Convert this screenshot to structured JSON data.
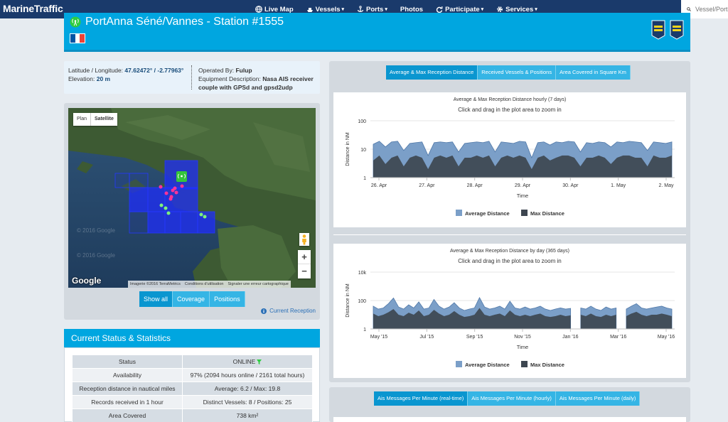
{
  "nav": {
    "logo": "MarineTraffic",
    "items": [
      {
        "label": "Live Map",
        "icon": "globe-icon",
        "caret": false
      },
      {
        "label": "Vessels",
        "icon": "ship-icon",
        "caret": true
      },
      {
        "label": "Ports",
        "icon": "anchor-icon",
        "caret": true
      },
      {
        "label": "Photos",
        "icon": "",
        "caret": false
      },
      {
        "label": "Participate",
        "icon": "refresh-icon",
        "caret": true
      },
      {
        "label": "Services",
        "icon": "gear-icon",
        "caret": true
      }
    ],
    "search_placeholder": "Vessel/Port"
  },
  "station": {
    "title": "PortAnna Séné/Vannes - Station #1555",
    "flag_colors": [
      "#0055a4",
      "#ffffff",
      "#ef4135"
    ],
    "accent": "#00a6e0"
  },
  "info": {
    "latlon_label": "Latitude / Longitude:",
    "latlon_value": "47.62472° / -2.77963°",
    "elevation_label": "Elevation:",
    "elevation_value": "20 m",
    "operated_label": "Operated By:",
    "operated_value": "Fulup",
    "equipment_label": "Equipment Description:",
    "equipment_value": "Nasa AIS receiver couple with GPSd and gpsd2udp"
  },
  "map": {
    "type_buttons": [
      "Plan",
      "Satellite"
    ],
    "watermark": "© 2016 Google",
    "google": "Google",
    "attribution": [
      "Imagerie ©2016 TerraMetrics",
      "Conditions d'utilisation",
      "Signaler une erreur cartographique"
    ],
    "view_buttons": [
      "Show all",
      "Coverage",
      "Positions"
    ],
    "current_reception": "Current Reception"
  },
  "status": {
    "heading": "Current Status & Statistics",
    "rows": [
      [
        "Status",
        "ONLINE"
      ],
      [
        "Availability",
        "97% (2094 hours online / 2161 total hours)"
      ],
      [
        "Reception distance in nautical miles",
        "Average: 6.2 / Max: 19.8"
      ],
      [
        "Records received in 1 hour",
        "Distinct Vessels: 8 / Positions: 25"
      ],
      [
        "Area Covered",
        "738 km²"
      ]
    ]
  },
  "charts": {
    "tabs_top": [
      "Average & Max Reception Distance",
      "Received Vessels & Positions",
      "Area Covered in Square Km"
    ],
    "tabs_bottom": [
      "Ais Messages Per Minute (real-time)",
      "Ais Messages Per Minute (hourly)",
      "Ais Messages Per Minute (daily)"
    ],
    "zoom_hint": "Click and drag in the plot area to zoom in"
  },
  "chart_data": [
    {
      "type": "area",
      "title": "Average & Max Reception Distance hourly (7 days)",
      "xlabel": "Time",
      "ylabel": "Distance in NM",
      "yscale": "log",
      "ylim": [
        1,
        100
      ],
      "y_ticks": [
        "1",
        "10",
        "100"
      ],
      "x_ticks": [
        "26. Apr",
        "27. Apr",
        "28. Apr",
        "29. Apr",
        "30. Apr",
        "1. May",
        "2. May"
      ],
      "legend": "bottom-center",
      "series": [
        {
          "name": "Average Distance",
          "color": "#7b9fc8"
        },
        {
          "name": "Max Distance",
          "color": "#3d4650"
        }
      ],
      "max_values": [
        15,
        19,
        12,
        18,
        19,
        9,
        16,
        17,
        18,
        6,
        17,
        18,
        17,
        18,
        8,
        16,
        17,
        18,
        17,
        19,
        8,
        18,
        17,
        16,
        19,
        18,
        5,
        17,
        18,
        14,
        18,
        17,
        19,
        18,
        8,
        17,
        16,
        18,
        17,
        12,
        18,
        17,
        19,
        18,
        17,
        9,
        18,
        17,
        16,
        18
      ],
      "avg_values": [
        4,
        6,
        3,
        5,
        6,
        2.5,
        5,
        6,
        5,
        2,
        5,
        6,
        5,
        6,
        2.5,
        5,
        5,
        6,
        5,
        6,
        2.5,
        5,
        6,
        5,
        6,
        5,
        2,
        5,
        6,
        4,
        5,
        6,
        6,
        5,
        2.5,
        5,
        5,
        6,
        5,
        3,
        5,
        6,
        6,
        5,
        5,
        2.5,
        6,
        5,
        5,
        6
      ]
    },
    {
      "type": "area",
      "title": "Average & Max Reception Distance by day (365 days)",
      "xlabel": "Time",
      "ylabel": "Distance in NM",
      "yscale": "log",
      "ylim": [
        1,
        10000
      ],
      "y_ticks": [
        "1",
        "100",
        "10k"
      ],
      "x_ticks": [
        "May '15",
        "Jul '15",
        "Sep '15",
        "Nov '15",
        "Jan '16",
        "Mar '16",
        "May '16"
      ],
      "legend": "bottom-center",
      "series": [
        {
          "name": "Average Distance",
          "color": "#7b9fc8"
        },
        {
          "name": "Max Distance",
          "color": "#3d4650"
        }
      ],
      "max_values": [
        40,
        25,
        30,
        60,
        150,
        35,
        25,
        50,
        30,
        80,
        25,
        30,
        120,
        40,
        25,
        35,
        70,
        30,
        20,
        25,
        30,
        160,
        35,
        25,
        30,
        40,
        25,
        90,
        30,
        25,
        35,
        25,
        30,
        40,
        25,
        20,
        25,
        30,
        25,
        28,
        null,
        30,
        25,
        40,
        25,
        20,
        35,
        25,
        30,
        null,
        25,
        40,
        60,
        30,
        25,
        30,
        35,
        40,
        30,
        25
      ],
      "avg_values": [
        12,
        8,
        10,
        15,
        25,
        10,
        8,
        14,
        10,
        20,
        8,
        10,
        22,
        12,
        8,
        10,
        18,
        10,
        7,
        8,
        10,
        30,
        10,
        8,
        10,
        12,
        8,
        20,
        10,
        8,
        10,
        8,
        10,
        12,
        8,
        7,
        8,
        10,
        8,
        9,
        null,
        10,
        8,
        12,
        8,
        7,
        10,
        8,
        10,
        null,
        8,
        12,
        16,
        10,
        8,
        10,
        10,
        12,
        10,
        8
      ]
    }
  ]
}
